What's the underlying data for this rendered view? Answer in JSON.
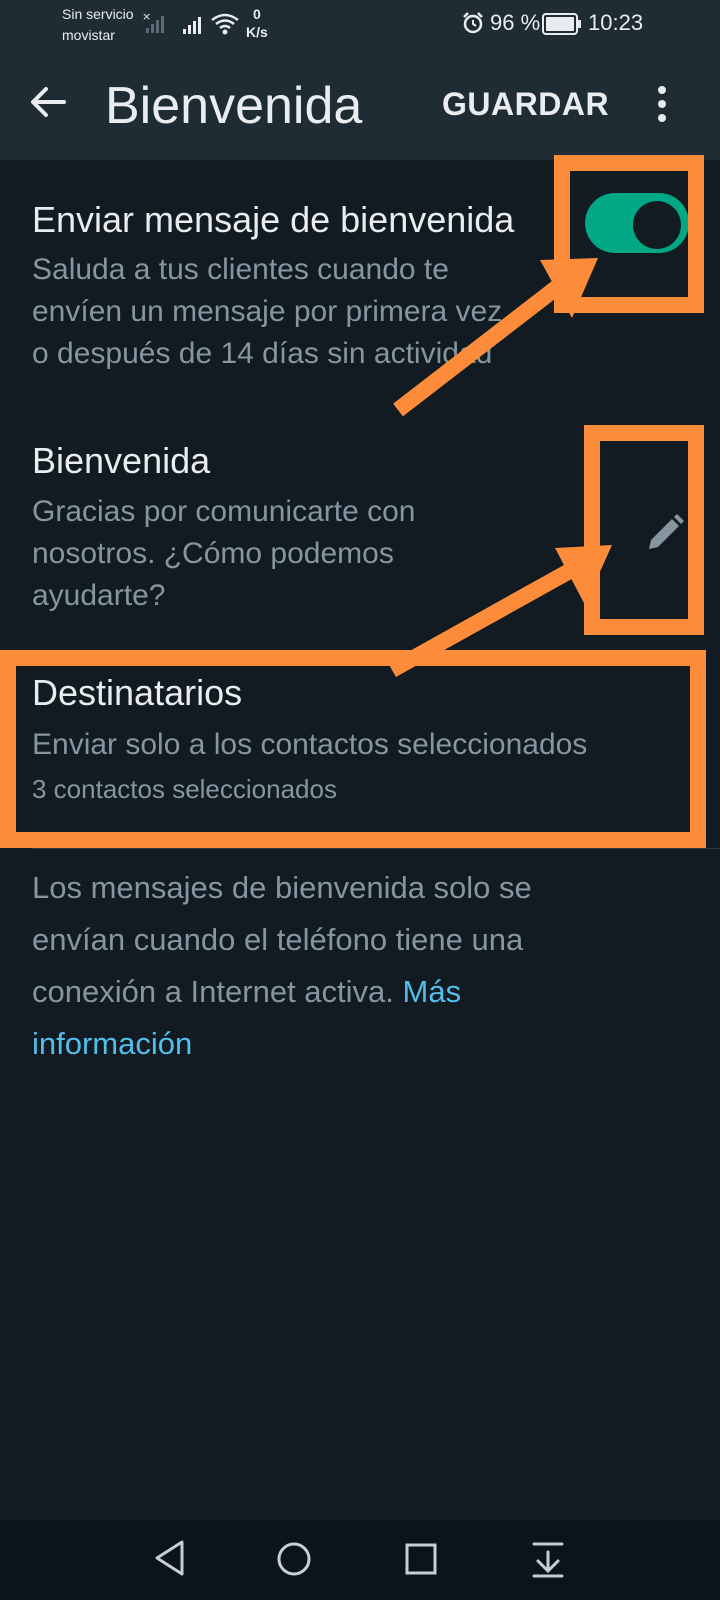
{
  "status_bar": {
    "carrier_line1": "Sin servicio",
    "carrier_line2": "movistar",
    "speed_value": "0",
    "speed_unit": "K/s",
    "battery": "96 %",
    "time": "10:23"
  },
  "app_bar": {
    "title": "Bienvenida",
    "save_label": "GUARDAR"
  },
  "welcome_toggle": {
    "title": "Enviar mensaje de bienvenida",
    "description_lines": [
      "Saluda a tus clientes cuando te",
      "envíen un mensaje por primera vez",
      "o después de 14 días sin actividad"
    ],
    "enabled": true
  },
  "message": {
    "title": "Bienvenida",
    "text_lines": [
      "Gracias por comunicarte con",
      "nosotros. ¿Cómo podemos",
      "ayudarte?"
    ]
  },
  "recipients": {
    "title": "Destinatarios",
    "mode": "Enviar solo a los contactos seleccionados",
    "count": "3 contactos seleccionados"
  },
  "footer": {
    "lines": [
      "Los mensajes de bienvenida solo se",
      "envían cuando el teléfono tiene una",
      "conexión a Internet activa."
    ],
    "link_line1": "Más",
    "link_line2": "información"
  },
  "colors": {
    "background": "#111b21",
    "toolbar": "#1f2c34",
    "toggle_on": "#00a884",
    "link": "#53bdeb",
    "annotation": "#fd8c3a"
  }
}
